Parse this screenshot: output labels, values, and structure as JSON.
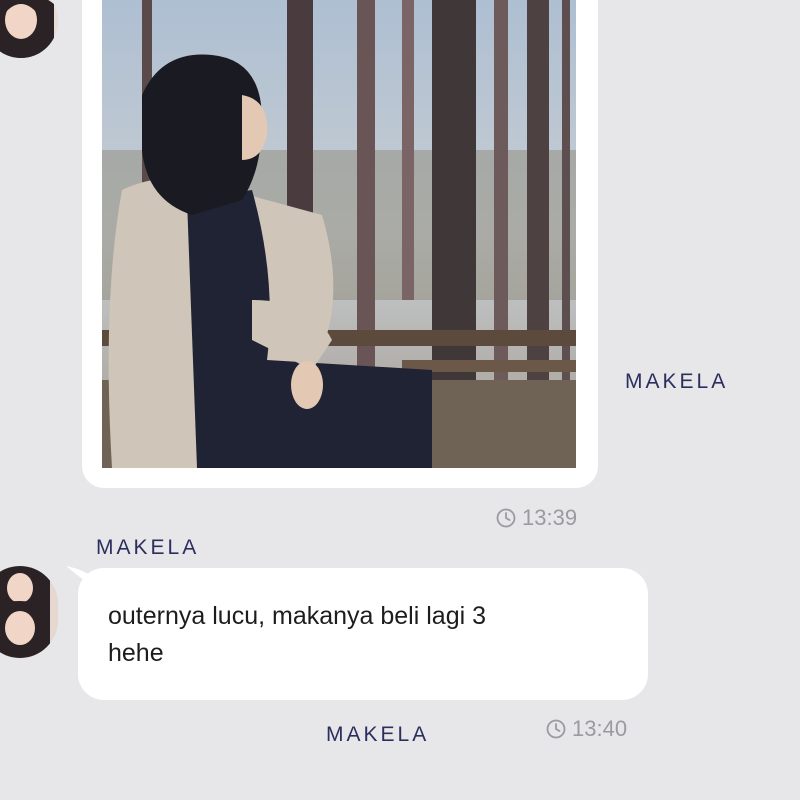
{
  "messages": [
    {
      "type": "image",
      "image_description": "woman in hijab sitting on bench in pine forest",
      "time": "13:39"
    },
    {
      "type": "text",
      "text_line1": "outernya lucu, makanya beli lagi 3",
      "text_line2": "hehe",
      "time": "13:40"
    }
  ],
  "watermark": "MAKELA",
  "icons": {
    "clock": "clock-icon",
    "avatar": "contact-avatar"
  },
  "colors": {
    "background": "#e7e7e9",
    "bubble": "#ffffff",
    "watermark": "#2c2f5e",
    "timestamp": "#9a9aa0"
  }
}
